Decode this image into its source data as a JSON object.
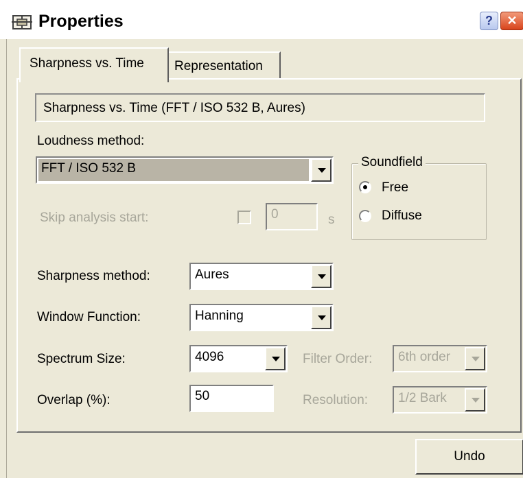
{
  "window": {
    "title": "Properties",
    "help_label": "?",
    "close_label": "✕"
  },
  "tabs": [
    {
      "label": "Sharpness vs. Time",
      "selected": true
    },
    {
      "label": "Representation",
      "selected": false
    }
  ],
  "description": "Sharpness vs. Time (FFT / ISO 532 B, Aures)",
  "loudness": {
    "label": "Loudness method:",
    "value": "FFT / ISO 532 B"
  },
  "soundfield": {
    "title": "Soundfield",
    "options": [
      {
        "label": "Free",
        "selected": true
      },
      {
        "label": "Diffuse",
        "selected": false
      }
    ]
  },
  "skip": {
    "label": "Skip analysis start:",
    "value": "0",
    "unit": "s",
    "checked": false
  },
  "sharpness_method": {
    "label": "Sharpness method:",
    "value": "Aures"
  },
  "window_function": {
    "label": "Window Function:",
    "value": "Hanning"
  },
  "spectrum_size": {
    "label": "Spectrum Size:",
    "value": "4096"
  },
  "filter_order": {
    "label": "Filter Order:",
    "value": "6th order"
  },
  "overlap": {
    "label": "Overlap (%):",
    "value": "50"
  },
  "resolution": {
    "label": "Resolution:",
    "value": "1/2 Bark"
  },
  "buttons": {
    "undo": "Undo"
  },
  "colors": {
    "dialog_bg": "#ece9d8",
    "disabled_text": "#a7a69a",
    "selection_bg": "#b9b4a6"
  }
}
